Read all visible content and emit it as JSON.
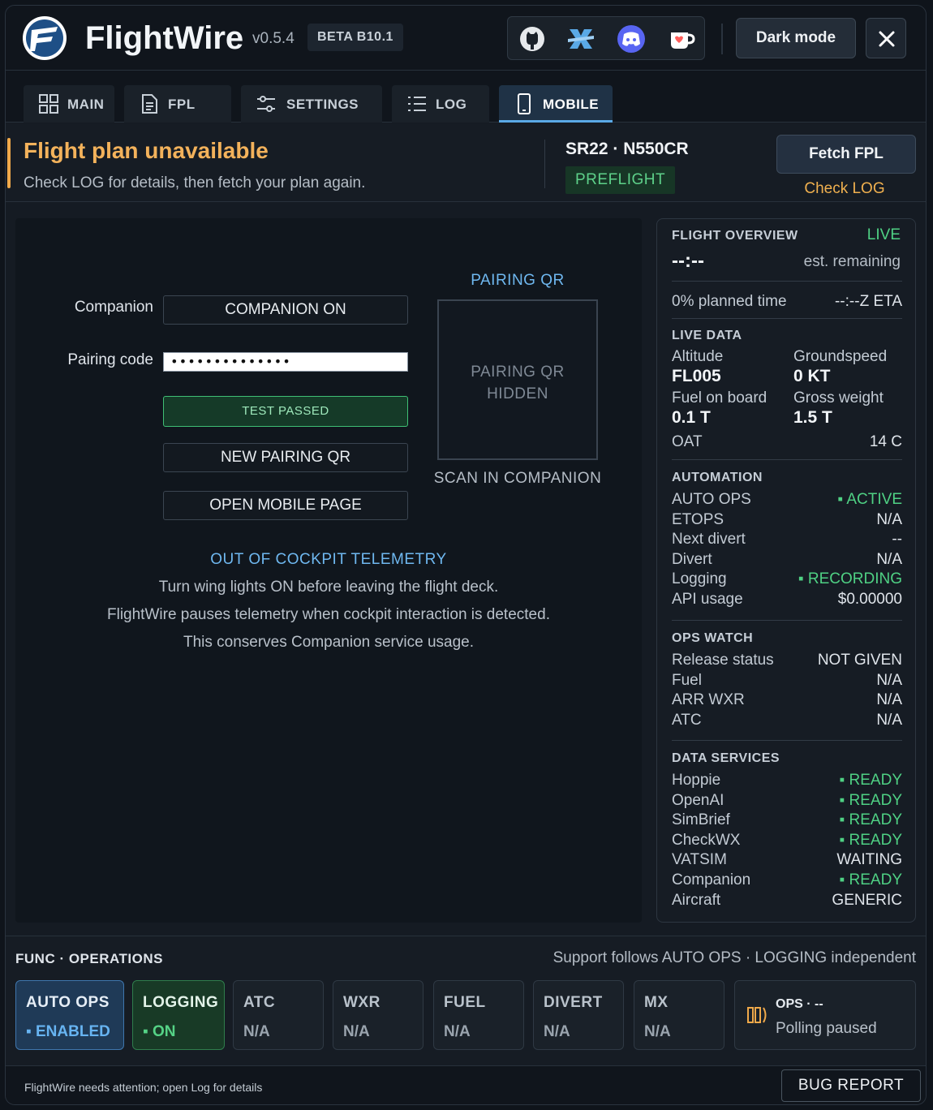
{
  "header": {
    "brand": "FlightWire",
    "version": "v0.5.4",
    "beta": "BETA B10.1",
    "social": [
      "github-icon",
      "xplane-icon",
      "discord-icon",
      "kofi-icon"
    ],
    "dark_mode_label": "Dark mode"
  },
  "tabs": [
    {
      "label": "MAIN",
      "icon": "grid-icon"
    },
    {
      "label": "FPL",
      "icon": "document-icon"
    },
    {
      "label": "SETTINGS",
      "icon": "sliders-icon"
    },
    {
      "label": "LOG",
      "icon": "list-icon"
    },
    {
      "label": "MOBILE",
      "icon": "phone-icon",
      "active": true
    }
  ],
  "banner": {
    "title": "Flight plan unavailable",
    "subtitle": "Check LOG for details, then fetch your plan again.",
    "aircraft": "SR22 · N550CR",
    "phase": "PREFLIGHT",
    "fetch_label": "Fetch FPL",
    "check_log": "Check LOG"
  },
  "mobile": {
    "companion_label": "Companion",
    "companion_button": "COMPANION ON",
    "pairing_label": "Pairing code",
    "pairing_value": "••••••••••••••",
    "test_button": "TEST PASSED",
    "new_qr_button": "NEW PAIRING QR",
    "open_mobile_button": "OPEN MOBILE PAGE",
    "qr_title": "PAIRING QR",
    "qr_hidden_1": "PAIRING QR",
    "qr_hidden_2": "HIDDEN",
    "scan_label": "SCAN IN COMPANION",
    "telemetry_title": "OUT OF COCKPIT TELEMETRY",
    "telemetry_lines": [
      "Turn wing lights ON before leaving the flight deck.",
      "FlightWire pauses telemetry when cockpit interaction is detected.",
      "This conserves Companion service usage."
    ]
  },
  "overview": {
    "title": "FLIGHT OVERVIEW",
    "live": "LIVE",
    "time": "--:--",
    "est_remaining": "est. remaining",
    "planned": "0% planned time",
    "eta": "--:--Z ETA"
  },
  "live_data": {
    "title": "LIVE DATA",
    "altitude_label": "Altitude",
    "altitude": "FL005",
    "groundspeed_label": "Groundspeed",
    "groundspeed": "0 KT",
    "fuel_label": "Fuel on board",
    "fuel": "0.1 T",
    "weight_label": "Gross weight",
    "weight": "1.5 T",
    "oat_label": "OAT",
    "oat": "14 C"
  },
  "automation": {
    "title": "AUTOMATION",
    "rows": [
      {
        "k": "AUTO OPS",
        "v": "▪ ACTIVE",
        "ok": true
      },
      {
        "k": "ETOPS",
        "v": "N/A"
      },
      {
        "k": "Next divert",
        "v": "--"
      },
      {
        "k": "Divert",
        "v": "N/A"
      },
      {
        "k": "Logging",
        "v": "▪ RECORDING",
        "ok": true
      },
      {
        "k": "API usage",
        "v": "$0.00000"
      }
    ]
  },
  "ops_watch": {
    "title": "OPS WATCH",
    "rows": [
      {
        "k": "Release status",
        "v": "NOT GIVEN"
      },
      {
        "k": "Fuel",
        "v": "N/A"
      },
      {
        "k": "ARR WXR",
        "v": "N/A"
      },
      {
        "k": "ATC",
        "v": "N/A"
      }
    ]
  },
  "data_services": {
    "title": "DATA SERVICES",
    "rows": [
      {
        "k": "Hoppie",
        "v": "▪ READY",
        "ok": true
      },
      {
        "k": "OpenAI",
        "v": "▪ READY",
        "ok": true
      },
      {
        "k": "SimBrief",
        "v": "▪ READY",
        "ok": true
      },
      {
        "k": "CheckWX",
        "v": "▪ READY",
        "ok": true
      },
      {
        "k": "VATSIM",
        "v": "WAITING"
      },
      {
        "k": "Companion",
        "v": "▪ READY",
        "ok": true
      },
      {
        "k": "Aircraft",
        "v": "GENERIC"
      }
    ]
  },
  "operations": {
    "title": "FUNC · OPERATIONS",
    "note": "Support follows AUTO OPS · LOGGING independent",
    "cards": [
      {
        "t": "AUTO OPS",
        "s": "▪ ENABLED",
        "style": "blue"
      },
      {
        "t": "LOGGING",
        "s": "▪ ON",
        "style": "green"
      },
      {
        "t": "ATC",
        "s": "N/A"
      },
      {
        "t": "WXR",
        "s": "N/A"
      },
      {
        "t": "FUEL",
        "s": "N/A"
      },
      {
        "t": "DIVERT",
        "s": "N/A"
      },
      {
        "t": "MX",
        "s": "N/A"
      }
    ],
    "status_title": "OPS · --",
    "status_sub": "Polling paused"
  },
  "statusbar": {
    "message": "FlightWire needs attention; open Log for details",
    "bug_report": "BUG REPORT"
  },
  "colors": {
    "accent_blue": "#5aa9e6",
    "warning": "#f3b25b",
    "ok_green": "#4fd184"
  }
}
